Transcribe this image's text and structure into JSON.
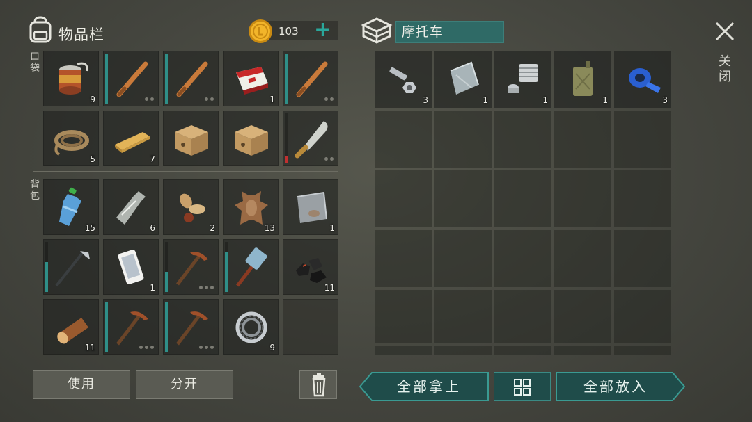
{
  "inventory": {
    "title": "物品栏",
    "coins": "103",
    "pocket_label": "口袋",
    "backpack_label": "背包"
  },
  "container": {
    "title": "摩托车",
    "close_label": "关闭"
  },
  "pocket_slots": [
    {
      "item": "canned-food",
      "count": "9"
    },
    {
      "item": "baseball-bat"
    },
    {
      "item": "baseball-bat"
    },
    {
      "item": "cigarette-pack",
      "count": "1"
    },
    {
      "item": "baseball-bat"
    },
    {
      "item": "rope",
      "count": "5"
    },
    {
      "item": "wooden-plank",
      "count": "7"
    },
    {
      "item": "cardboard-box"
    },
    {
      "item": "cardboard-box"
    },
    {
      "item": "machete"
    }
  ],
  "backpack_slots": [
    {
      "item": "water-bottle",
      "count": "15"
    },
    {
      "item": "empty-bottle",
      "count": "6"
    },
    {
      "item": "seeds",
      "count": "2"
    },
    {
      "item": "animal-hide",
      "count": "13"
    },
    {
      "item": "metal-scrap",
      "count": "1"
    },
    {
      "item": "hoe"
    },
    {
      "item": "smartphone",
      "count": "1"
    },
    {
      "item": "pickaxe"
    },
    {
      "item": "sledgehammer"
    },
    {
      "item": "coal",
      "count": "11"
    },
    {
      "item": "log",
      "count": "11"
    },
    {
      "item": "pickaxe"
    },
    {
      "item": "pickaxe"
    },
    {
      "item": "bearing",
      "count": "9"
    },
    {
      "item": "empty"
    }
  ],
  "container_slots": [
    {
      "item": "bolts-and-nuts",
      "count": "3"
    },
    {
      "item": "metal-plate",
      "count": "1"
    },
    {
      "item": "engine-cylinder",
      "count": "1"
    },
    {
      "item": "jerry-can",
      "count": "1"
    },
    {
      "item": "duct-tape",
      "count": "3"
    }
  ],
  "buttons": {
    "use": "使用",
    "split": "分开",
    "take_all": "全部拿上",
    "put_all": "全部放入"
  },
  "colors": {
    "accent_teal": "#2aa79b",
    "durability_teal": "#2f8f88",
    "durability_low": "#c03030"
  }
}
